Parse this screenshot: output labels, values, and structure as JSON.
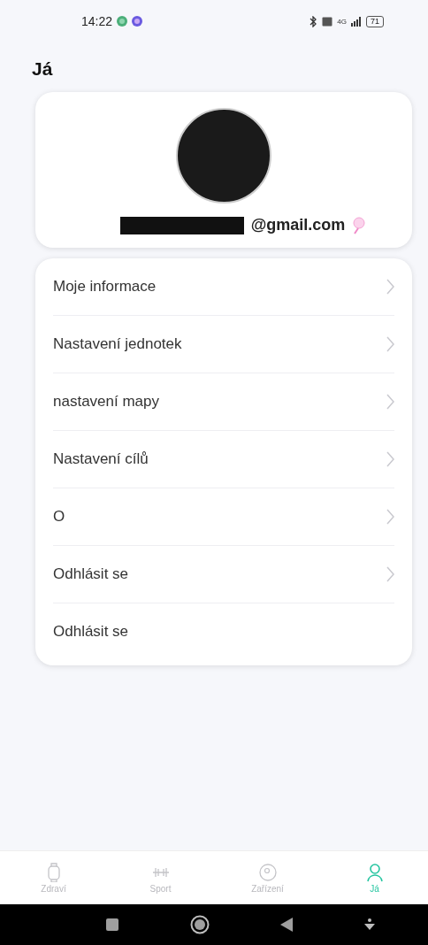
{
  "status_bar": {
    "time": "14:22",
    "network": "4G",
    "battery": "71"
  },
  "title": "Já",
  "profile": {
    "email": "@gmail.com"
  },
  "menu": [
    {
      "label": "Moje informace",
      "chevron": true
    },
    {
      "label": "Nastavení jednotek",
      "chevron": true
    },
    {
      "label": "nastavení mapy",
      "chevron": true
    },
    {
      "label": "Nastavení cílů",
      "chevron": true
    },
    {
      "label": "O",
      "chevron": true
    },
    {
      "label": "Odhlásit se",
      "chevron": true
    },
    {
      "label": "Odhlásit se",
      "chevron": false
    }
  ],
  "tabs": [
    {
      "label": "Zdraví",
      "kind": "watch",
      "selected": false
    },
    {
      "label": "Sport",
      "kind": "dumbbell",
      "selected": false
    },
    {
      "label": "Zařízení",
      "kind": "device",
      "selected": false
    },
    {
      "label": "Já",
      "kind": "person",
      "selected": true
    }
  ]
}
